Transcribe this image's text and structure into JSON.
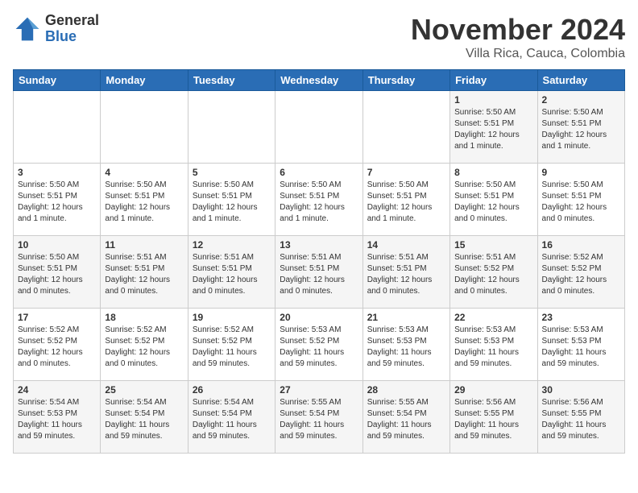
{
  "logo": {
    "general": "General",
    "blue": "Blue"
  },
  "title": "November 2024",
  "location": "Villa Rica, Cauca, Colombia",
  "days_of_week": [
    "Sunday",
    "Monday",
    "Tuesday",
    "Wednesday",
    "Thursday",
    "Friday",
    "Saturday"
  ],
  "weeks": [
    [
      {
        "day": "",
        "info": ""
      },
      {
        "day": "",
        "info": ""
      },
      {
        "day": "",
        "info": ""
      },
      {
        "day": "",
        "info": ""
      },
      {
        "day": "",
        "info": ""
      },
      {
        "day": "1",
        "info": "Sunrise: 5:50 AM\nSunset: 5:51 PM\nDaylight: 12 hours and 1 minute."
      },
      {
        "day": "2",
        "info": "Sunrise: 5:50 AM\nSunset: 5:51 PM\nDaylight: 12 hours and 1 minute."
      }
    ],
    [
      {
        "day": "3",
        "info": "Sunrise: 5:50 AM\nSunset: 5:51 PM\nDaylight: 12 hours and 1 minute."
      },
      {
        "day": "4",
        "info": "Sunrise: 5:50 AM\nSunset: 5:51 PM\nDaylight: 12 hours and 1 minute."
      },
      {
        "day": "5",
        "info": "Sunrise: 5:50 AM\nSunset: 5:51 PM\nDaylight: 12 hours and 1 minute."
      },
      {
        "day": "6",
        "info": "Sunrise: 5:50 AM\nSunset: 5:51 PM\nDaylight: 12 hours and 1 minute."
      },
      {
        "day": "7",
        "info": "Sunrise: 5:50 AM\nSunset: 5:51 PM\nDaylight: 12 hours and 1 minute."
      },
      {
        "day": "8",
        "info": "Sunrise: 5:50 AM\nSunset: 5:51 PM\nDaylight: 12 hours and 0 minutes."
      },
      {
        "day": "9",
        "info": "Sunrise: 5:50 AM\nSunset: 5:51 PM\nDaylight: 12 hours and 0 minutes."
      }
    ],
    [
      {
        "day": "10",
        "info": "Sunrise: 5:50 AM\nSunset: 5:51 PM\nDaylight: 12 hours and 0 minutes."
      },
      {
        "day": "11",
        "info": "Sunrise: 5:51 AM\nSunset: 5:51 PM\nDaylight: 12 hours and 0 minutes."
      },
      {
        "day": "12",
        "info": "Sunrise: 5:51 AM\nSunset: 5:51 PM\nDaylight: 12 hours and 0 minutes."
      },
      {
        "day": "13",
        "info": "Sunrise: 5:51 AM\nSunset: 5:51 PM\nDaylight: 12 hours and 0 minutes."
      },
      {
        "day": "14",
        "info": "Sunrise: 5:51 AM\nSunset: 5:51 PM\nDaylight: 12 hours and 0 minutes."
      },
      {
        "day": "15",
        "info": "Sunrise: 5:51 AM\nSunset: 5:52 PM\nDaylight: 12 hours and 0 minutes."
      },
      {
        "day": "16",
        "info": "Sunrise: 5:52 AM\nSunset: 5:52 PM\nDaylight: 12 hours and 0 minutes."
      }
    ],
    [
      {
        "day": "17",
        "info": "Sunrise: 5:52 AM\nSunset: 5:52 PM\nDaylight: 12 hours and 0 minutes."
      },
      {
        "day": "18",
        "info": "Sunrise: 5:52 AM\nSunset: 5:52 PM\nDaylight: 12 hours and 0 minutes."
      },
      {
        "day": "19",
        "info": "Sunrise: 5:52 AM\nSunset: 5:52 PM\nDaylight: 11 hours and 59 minutes."
      },
      {
        "day": "20",
        "info": "Sunrise: 5:53 AM\nSunset: 5:52 PM\nDaylight: 11 hours and 59 minutes."
      },
      {
        "day": "21",
        "info": "Sunrise: 5:53 AM\nSunset: 5:53 PM\nDaylight: 11 hours and 59 minutes."
      },
      {
        "day": "22",
        "info": "Sunrise: 5:53 AM\nSunset: 5:53 PM\nDaylight: 11 hours and 59 minutes."
      },
      {
        "day": "23",
        "info": "Sunrise: 5:53 AM\nSunset: 5:53 PM\nDaylight: 11 hours and 59 minutes."
      }
    ],
    [
      {
        "day": "24",
        "info": "Sunrise: 5:54 AM\nSunset: 5:53 PM\nDaylight: 11 hours and 59 minutes."
      },
      {
        "day": "25",
        "info": "Sunrise: 5:54 AM\nSunset: 5:54 PM\nDaylight: 11 hours and 59 minutes."
      },
      {
        "day": "26",
        "info": "Sunrise: 5:54 AM\nSunset: 5:54 PM\nDaylight: 11 hours and 59 minutes."
      },
      {
        "day": "27",
        "info": "Sunrise: 5:55 AM\nSunset: 5:54 PM\nDaylight: 11 hours and 59 minutes."
      },
      {
        "day": "28",
        "info": "Sunrise: 5:55 AM\nSunset: 5:54 PM\nDaylight: 11 hours and 59 minutes."
      },
      {
        "day": "29",
        "info": "Sunrise: 5:56 AM\nSunset: 5:55 PM\nDaylight: 11 hours and 59 minutes."
      },
      {
        "day": "30",
        "info": "Sunrise: 5:56 AM\nSunset: 5:55 PM\nDaylight: 11 hours and 59 minutes."
      }
    ]
  ]
}
